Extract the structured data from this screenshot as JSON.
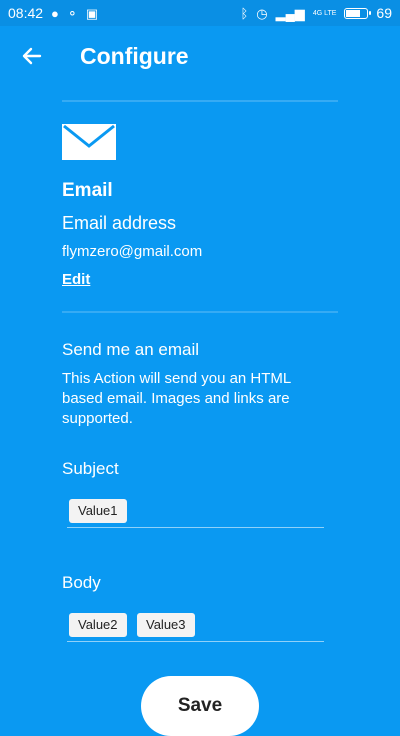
{
  "status_bar": {
    "time": "08:42",
    "network": "4G LTE",
    "battery": "69"
  },
  "app_bar": {
    "title": "Configure"
  },
  "email_section": {
    "title": "Email",
    "address_label": "Email address",
    "address_value": "flymzero@gmail.com",
    "edit_link": "Edit"
  },
  "action": {
    "title": "Send me an email",
    "description": "This Action will send you an HTML based email. Images and links are supported."
  },
  "subject": {
    "label": "Subject",
    "chips": [
      "Value1"
    ]
  },
  "body": {
    "label": "Body",
    "chips": [
      "Value2",
      "Value3"
    ]
  },
  "save_label": "Save",
  "colors": {
    "background": "#0A99F2",
    "status_bar": "#0A8FE4",
    "chip_bg": "#F3F3F3"
  }
}
